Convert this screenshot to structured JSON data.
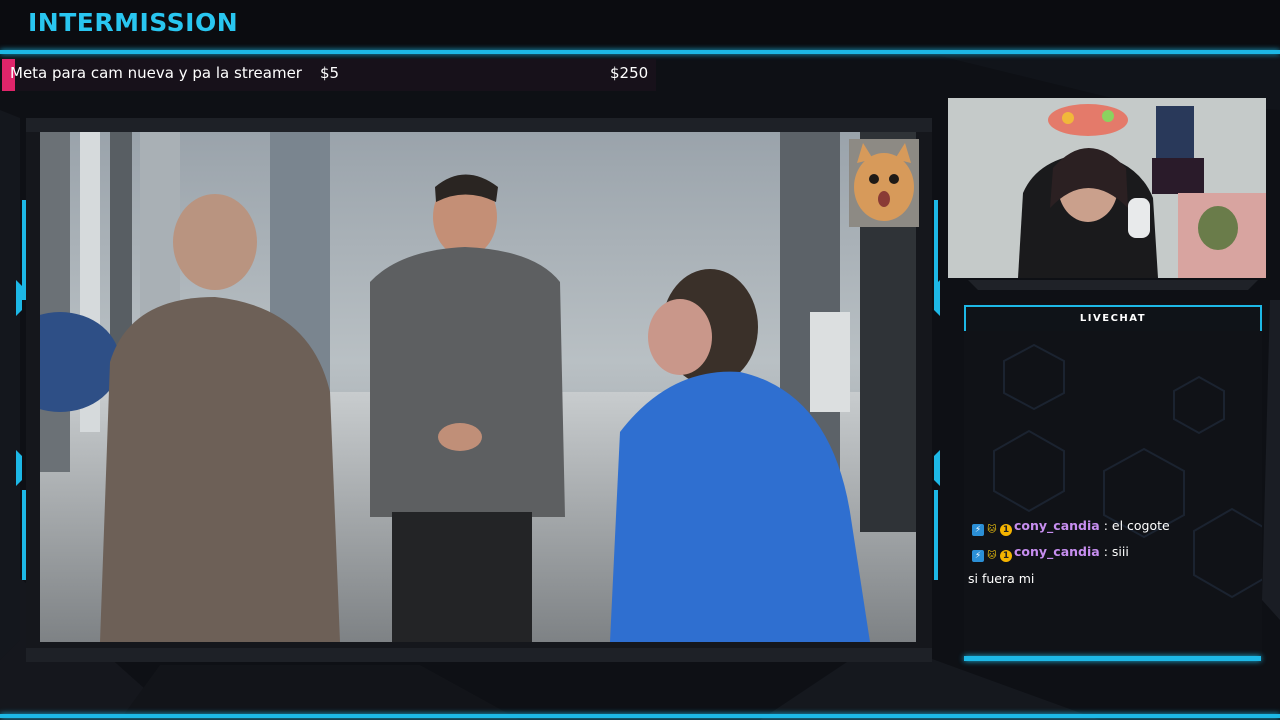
{
  "header": {
    "title": "INTERMISSION",
    "accent_color": "#1db8e6"
  },
  "goal": {
    "label": "Meta para cam nueva y pa la streamer",
    "current": "$5",
    "target": "$250",
    "progress_fraction": 0.02,
    "fill_color": "#e0256a"
  },
  "video": {
    "overlay_icon": "cat-face-icon"
  },
  "webcam": {
    "icon": "webcam-feed"
  },
  "chat": {
    "header_label": "LIVECHAT",
    "messages": [
      {
        "user": "cony_candia",
        "separator": " : ",
        "text": "el cogote",
        "badges": [
          "prime-icon",
          "cat-badge-icon",
          "sub-badge-icon"
        ],
        "badge_glyphs": [
          "⚡",
          "🐱",
          "1"
        ]
      },
      {
        "user": "cony_candia",
        "separator": " : ",
        "text": "siii",
        "badges": [
          "prime-icon",
          "cat-badge-icon",
          "sub-badge-icon"
        ],
        "badge_glyphs": [
          "⚡",
          "🐱",
          "1"
        ]
      },
      {
        "user": "",
        "separator": "",
        "text": "si fuera mi",
        "badges": [],
        "badge_glyphs": []
      }
    ],
    "username_color": "#c78ef0"
  }
}
